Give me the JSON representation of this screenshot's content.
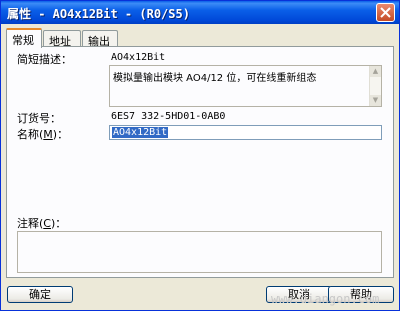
{
  "window": {
    "title": "属性 - AO4x12Bit - (R0/S5)"
  },
  "tabs": [
    {
      "label": "常规",
      "active": true
    },
    {
      "label": "地址",
      "active": false
    },
    {
      "label": "输出",
      "active": false
    }
  ],
  "general": {
    "short_desc_label": "简短描述：",
    "short_desc_value": "AO4x12Bit",
    "description_text": "模拟量输出模块 AO4/12 位，可在线重新组态",
    "order_no_label": "订货号：",
    "order_no_value": "6ES7 332-5HD01-0AB0",
    "name_label": "名称",
    "name_hotkey": "M",
    "name_value": "AO4x12Bit",
    "comment_label": "注释",
    "comment_hotkey": "C",
    "comment_value": ""
  },
  "buttons": {
    "ok": "确定",
    "cancel": "取消",
    "help": "帮助"
  },
  "watermark": "www.diangon.com"
}
